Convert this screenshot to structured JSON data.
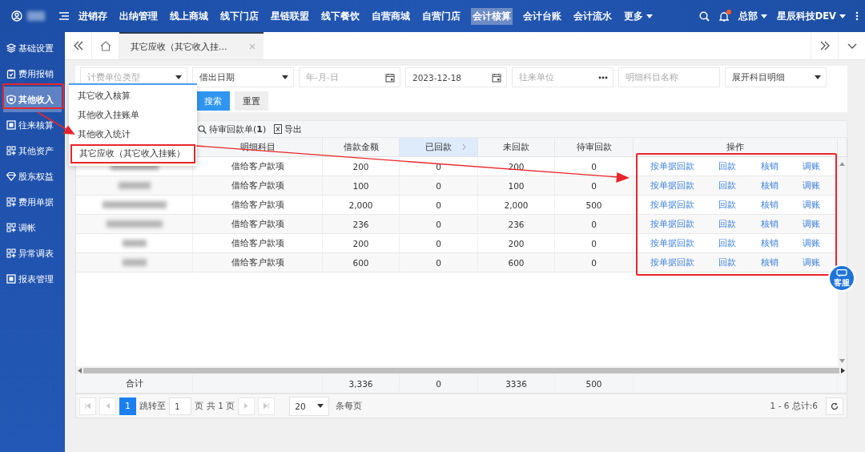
{
  "topbar": {
    "nav": [
      {
        "label": "进销存",
        "selected": false
      },
      {
        "label": "出纳管理",
        "selected": false
      },
      {
        "label": "线上商城",
        "selected": false
      },
      {
        "label": "线下门店",
        "selected": false
      },
      {
        "label": "星链联盟",
        "selected": false
      },
      {
        "label": "线下餐饮",
        "selected": false
      },
      {
        "label": "自营商城",
        "selected": false
      },
      {
        "label": "自营门店",
        "selected": false
      },
      {
        "label": "会计核算",
        "selected": true
      },
      {
        "label": "会计台账",
        "selected": false
      },
      {
        "label": "会计流水",
        "selected": false
      }
    ],
    "more": "更多",
    "org": "总部",
    "company": "星辰科技DEV",
    "notification": true
  },
  "sidebar": {
    "items": [
      {
        "label": "基础设置",
        "kind": "layers",
        "selected": false
      },
      {
        "label": "费用报销",
        "kind": "clipboard",
        "selected": false
      },
      {
        "label": "其他收入",
        "kind": "shield",
        "selected": true
      },
      {
        "label": "往来核算",
        "kind": "frame",
        "selected": false
      },
      {
        "label": "其他资产",
        "kind": "grid",
        "selected": false
      },
      {
        "label": "股东权益",
        "kind": "diamond",
        "selected": false
      },
      {
        "label": "费用单据",
        "kind": "grid",
        "selected": false
      },
      {
        "label": "调帐",
        "kind": "grid",
        "selected": false
      },
      {
        "label": "异常调表",
        "kind": "grid",
        "selected": false
      },
      {
        "label": "报表管理",
        "kind": "frame",
        "selected": false
      }
    ]
  },
  "tabs": [
    {
      "label": "其它应收（其它收入挂...",
      "selected": true
    }
  ],
  "filters": [
    {
      "kind": "select",
      "placeholder": "计费单位类型"
    },
    {
      "kind": "select",
      "value": "借出日期"
    },
    {
      "kind": "date",
      "placeholder": "年-月-日"
    },
    {
      "kind": "date",
      "value": "2023-12-18"
    },
    {
      "kind": "lookup",
      "placeholder": "往来单位"
    },
    {
      "kind": "text",
      "placeholder": "明细科目名称"
    },
    {
      "kind": "select",
      "value": "展开科目明细"
    }
  ],
  "buttons": [
    {
      "label": "搜索",
      "kind": "primary"
    },
    {
      "label": "重置",
      "kind": "default"
    }
  ],
  "toolbar": [
    {
      "kind": "search",
      "label": "待审回款单(**1**)"
    },
    {
      "kind": "export",
      "label": "导出"
    }
  ],
  "menu": {
    "items": [
      {
        "label": "其它收入核算",
        "highlighted": false
      },
      {
        "label": "其他收入挂账单",
        "highlighted": false
      },
      {
        "label": "其他收入统计",
        "highlighted": false
      },
      {
        "label": "其它应收（其它收入挂账）",
        "highlighted": true
      }
    ]
  },
  "table": {
    "columns": [
      {
        "label": "明细科目",
        "selected": false
      },
      {
        "label": "借款金额",
        "selected": false
      },
      {
        "label": "已回款",
        "selected": true
      },
      {
        "label": "未回款",
        "selected": false
      },
      {
        "label": "待审回款",
        "selected": false
      },
      {
        "label": "操作",
        "selected": false
      }
    ],
    "rows": [
      {
        "subject": "借给客户款项",
        "amount": "200",
        "received": "0",
        "outstanding": "200",
        "pending": "0",
        "actions": [
          "按单据回款",
          "回款",
          "核销",
          "调账"
        ]
      },
      {
        "subject": "借给客户款项",
        "amount": "100",
        "received": "0",
        "outstanding": "100",
        "pending": "0",
        "actions": [
          "按单据回款",
          "回款",
          "核销",
          "调账"
        ]
      },
      {
        "subject": "借给客户款项",
        "amount": "2,000",
        "received": "0",
        "outstanding": "2,000",
        "pending": "500",
        "actions": [
          "按单据回款",
          "回款",
          "核销",
          "调账"
        ]
      },
      {
        "subject": "借给客户款项",
        "amount": "236",
        "received": "0",
        "outstanding": "236",
        "pending": "0",
        "actions": [
          "按单据回款",
          "回款",
          "核销",
          "调账"
        ]
      },
      {
        "subject": "借给客户款项",
        "amount": "200",
        "received": "0",
        "outstanding": "200",
        "pending": "0",
        "actions": [
          "按单据回款",
          "回款",
          "核销",
          "调账"
        ]
      },
      {
        "subject": "借给客户款项",
        "amount": "600",
        "received": "0",
        "outstanding": "600",
        "pending": "0",
        "actions": [
          "按单据回款",
          "回款",
          "核销",
          "调账"
        ]
      }
    ],
    "totals": {
      "label": "合计",
      "amount": "3,336",
      "received": "0",
      "outstanding": "3336",
      "pending": "500"
    }
  },
  "pagination": {
    "page": "1",
    "jump_label": "跳转至",
    "jump_value": "1",
    "page_unit": "页",
    "total_pages": "共 1 页",
    "page_size": "20",
    "per_page_label": "条每页",
    "summary": "1 - 6 总计:6"
  },
  "service": {
    "label": "客服"
  }
}
